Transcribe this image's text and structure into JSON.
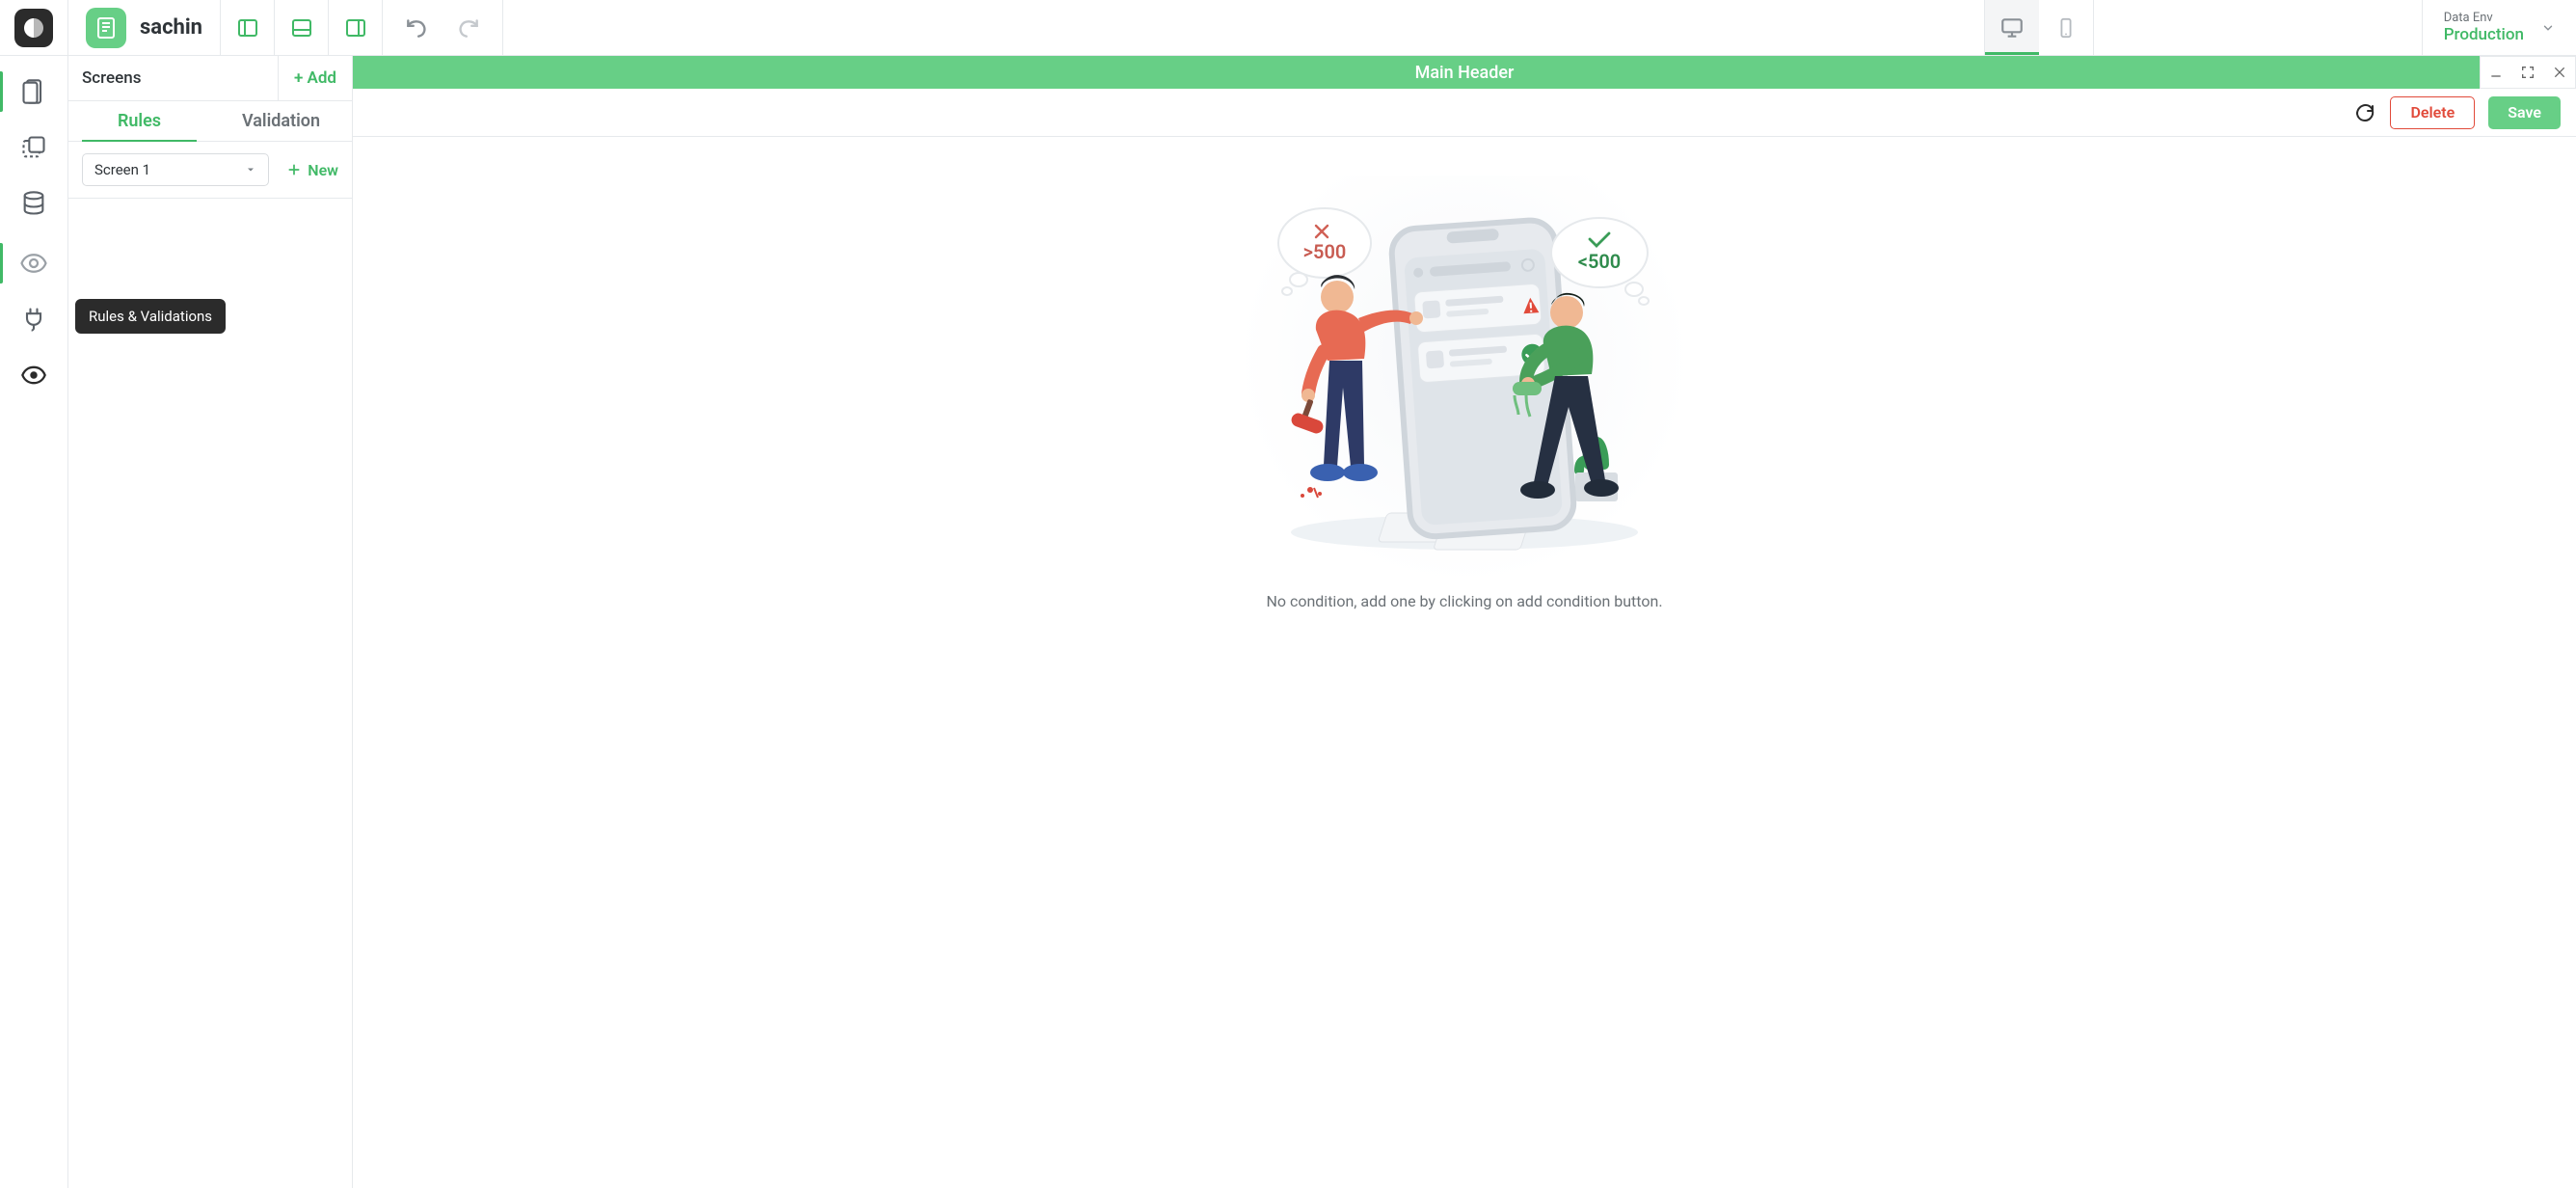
{
  "header": {
    "project_title": "sachin",
    "data_env_label": "Data Env",
    "data_env_value": "Production"
  },
  "rail": {
    "tooltip": "Rules & Validations"
  },
  "left_panel": {
    "screens_label": "Screens",
    "add_label": "+ Add",
    "tabs": {
      "rules": "Rules",
      "validation": "Validation"
    },
    "select_value": "Screen 1",
    "new_label": "New"
  },
  "canvas": {
    "main_header": "Main Header",
    "delete_label": "Delete",
    "save_label": "Save"
  },
  "illustration": {
    "left_bubble": ">500",
    "right_bubble": "<500"
  },
  "empty": {
    "text": "No condition, add one by clicking on add condition button."
  }
}
